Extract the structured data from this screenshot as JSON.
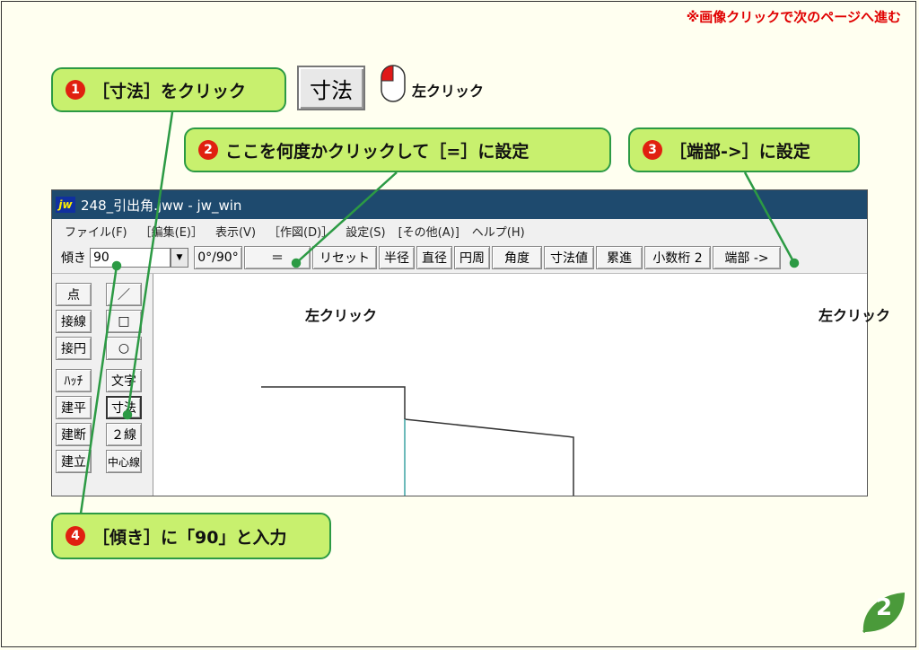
{
  "note": "※画像クリックで次のページへ進む",
  "callouts": [
    {
      "num": "1",
      "text": "［寸法］をクリック"
    },
    {
      "num": "2",
      "text": "ここを何度かクリックして［=］に設定"
    },
    {
      "num": "3",
      "text": "［端部->］に設定"
    },
    {
      "num": "4",
      "text": "［傾き］に「90」と入力"
    }
  ],
  "big_button_label": "寸法",
  "click_label": "左クリック",
  "window": {
    "icon": "jw",
    "title": "248_引出角.jww - jw_win",
    "menu": [
      "ファイル(F)",
      "［編集(E)］",
      "表示(V)",
      "［作図(D)］",
      "設定(S)",
      "[その他(A)]",
      "ヘルプ(H)"
    ],
    "toolbar": {
      "tilt_label": "傾き",
      "tilt_value": "90",
      "buttons": [
        "0°/90°",
        "＝",
        "リセット",
        "半径",
        "直径",
        "円周",
        "角度",
        "寸法値",
        "累進",
        "小数桁 2",
        "端部 ->"
      ]
    },
    "left_tools": {
      "col1": [
        "点",
        "接線",
        "接円",
        "ﾊｯﾁ",
        "建平",
        "建断",
        "建立"
      ],
      "col2": [
        "／",
        "□",
        "○",
        "文字",
        "寸法",
        "２線",
        "中心線"
      ]
    }
  },
  "page_number": "2",
  "colors": {
    "callout_bg": "#c8f06e",
    "callout_border": "#2c9a44",
    "number_badge": "#e02010",
    "title_bar": "#1e4a6e",
    "note": "#e00000",
    "page_badge": "#4a9a3a"
  }
}
